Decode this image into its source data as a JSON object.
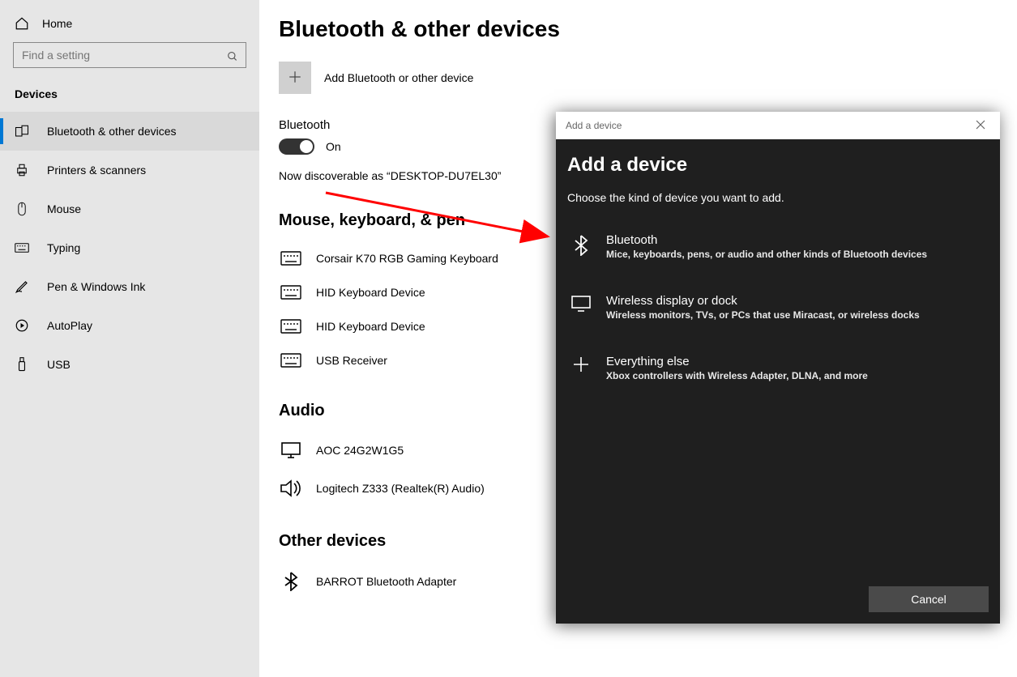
{
  "sidebar": {
    "home_label": "Home",
    "search_placeholder": "Find a setting",
    "section_label": "Devices",
    "items": [
      {
        "label": "Bluetooth & other devices",
        "icon": "bluetooth-devices"
      },
      {
        "label": "Printers & scanners",
        "icon": "printer"
      },
      {
        "label": "Mouse",
        "icon": "mouse"
      },
      {
        "label": "Typing",
        "icon": "keyboard"
      },
      {
        "label": "Pen & Windows Ink",
        "icon": "pen"
      },
      {
        "label": "AutoPlay",
        "icon": "autoplay"
      },
      {
        "label": "USB",
        "icon": "usb"
      }
    ]
  },
  "main": {
    "title": "Bluetooth & other devices",
    "add_label": "Add Bluetooth or other device",
    "bluetooth_heading": "Bluetooth",
    "bluetooth_state": "On",
    "discoverable_text": "Now discoverable as “DESKTOP-DU7EL30”",
    "section_mouse": "Mouse, keyboard, & pen",
    "devices_mouse": [
      "Corsair K70 RGB Gaming Keyboard",
      "HID Keyboard Device",
      "HID Keyboard Device",
      "USB Receiver"
    ],
    "section_audio": "Audio",
    "devices_audio": [
      "AOC 24G2W1G5",
      "Logitech Z333 (Realtek(R) Audio)"
    ],
    "section_other": "Other devices",
    "devices_other": [
      "BARROT Bluetooth Adapter"
    ]
  },
  "dialog": {
    "titlebar_text": "Add a device",
    "heading": "Add a device",
    "subtitle": "Choose the kind of device you want to add.",
    "options": [
      {
        "title": "Bluetooth",
        "subtitle": "Mice, keyboards, pens, or audio and other kinds of Bluetooth devices"
      },
      {
        "title": "Wireless display or dock",
        "subtitle": "Wireless monitors, TVs, or PCs that use Miracast, or wireless docks"
      },
      {
        "title": "Everything else",
        "subtitle": "Xbox controllers with Wireless Adapter, DLNA, and more"
      }
    ],
    "cancel_label": "Cancel"
  }
}
